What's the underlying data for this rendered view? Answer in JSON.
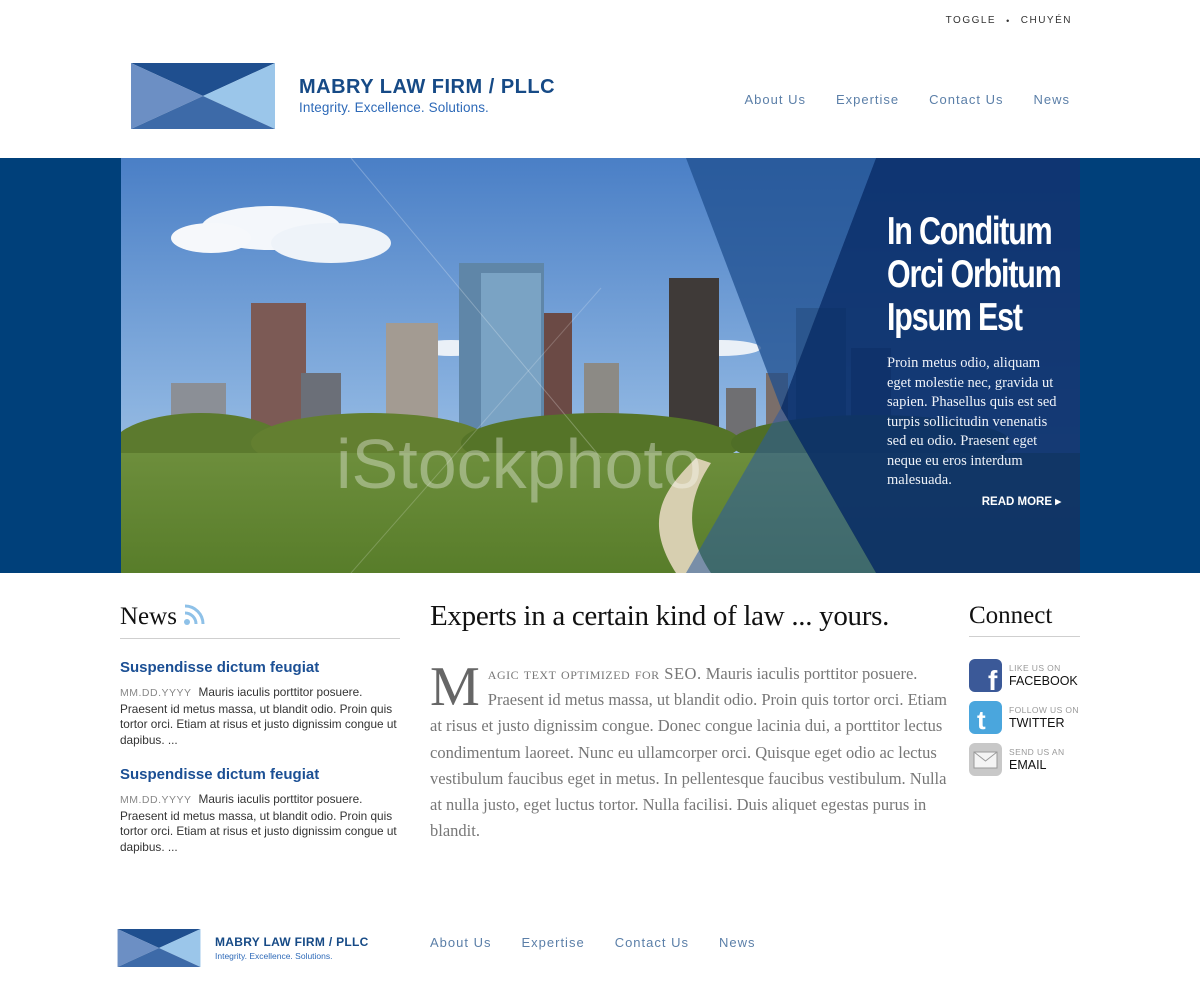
{
  "utility": {
    "toggle": "TOGGLE",
    "separator": "•",
    "language": "CHUYÉN"
  },
  "brand": {
    "name": "MABRY LAW FIRM / PLLC",
    "tagline": "Integrity.  Excellence.  Solutions.",
    "colors": {
      "dark_blue": "#1f4f8f",
      "mid_blue": "#6c8fc4",
      "light_blue": "#9bc6ea"
    }
  },
  "nav": {
    "items": [
      {
        "label": "About Us"
      },
      {
        "label": "Expertise"
      },
      {
        "label": "Contact Us"
      },
      {
        "label": "News"
      }
    ]
  },
  "hero": {
    "title": "In Conditum Orci Orbitum Ipsum Est",
    "text": "Proin metus odio, aliquam eget molestie nec, gravida ut sapien. Phasellus quis est sed turpis sollicitudin venenatis sed eu odio. Praesent eget neque eu eros interdum malesuada.",
    "read_more": "READ MORE ▸",
    "watermark": "iStockphoto",
    "background_color": "#00407a"
  },
  "news": {
    "title": "News",
    "icon": "rss-icon",
    "items": [
      {
        "headline": "Suspendisse dictum feugiat",
        "date": "MM.DD.YYYY",
        "summary": "Mauris iaculis porttitor posuere. Praesent id metus massa, ut blandit odio. Proin quis tortor orci. Etiam at risus et justo dignissim congue ut dapibus. ..."
      },
      {
        "headline": "Suspendisse dictum feugiat",
        "date": "MM.DD.YYYY",
        "summary": "Mauris iaculis porttitor posuere. Praesent id metus massa, ut blandit odio. Proin quis tortor orci. Etiam at risus et justo dignissim congue ut dapibus. ..."
      }
    ]
  },
  "main": {
    "heading": "Experts in a certain kind of law ... yours.",
    "dropcap": "M",
    "lead": "agic text optimized for SEO.",
    "body": " Mauris iaculis porttitor posuere. Praesent id metus massa, ut blandit odio. Proin quis tortor orci. Etiam at risus et justo dignissim congue. Donec congue lacinia dui, a porttitor lectus condimentum laoreet. Nunc eu ullamcorper orci. Quisque eget odio ac lectus vestibulum faucibus eget in metus. In pellentesque faucibus vestibulum. Nulla at nulla justo, eget luctus tortor. Nulla facilisi. Duis aliquet egestas purus in blandit."
  },
  "connect": {
    "title": "Connect",
    "items": [
      {
        "small": "LIKE US ON",
        "big": "FACEBOOK",
        "icon": "facebook-icon",
        "color": "#3b5998"
      },
      {
        "small": "FOLLOW US ON",
        "big": "TWITTER",
        "icon": "twitter-icon",
        "color": "#4aa6dd"
      },
      {
        "small": "SEND US AN",
        "big": "EMAIL",
        "icon": "email-icon",
        "color": "#c8c8c8"
      }
    ]
  },
  "footer": {
    "brand_name": "MABRY LAW FIRM / PLLC",
    "tagline": "Integrity.  Excellence.  Solutions.",
    "nav": [
      {
        "label": "About Us"
      },
      {
        "label": "Expertise"
      },
      {
        "label": "Contact Us"
      },
      {
        "label": "News"
      }
    ]
  }
}
